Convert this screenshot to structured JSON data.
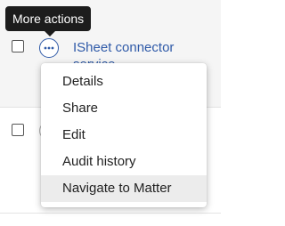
{
  "tooltip": {
    "text": "More actions"
  },
  "rows": [
    {
      "link_text": "ISheet connector service",
      "more_icon": "more-horizontal-circle-icon"
    },
    {
      "link_text": ""
    }
  ],
  "menu": {
    "items": [
      {
        "label": "Details"
      },
      {
        "label": "Share"
      },
      {
        "label": "Edit"
      },
      {
        "label": "Audit history"
      },
      {
        "label": "Navigate to Matter",
        "hovered": true
      }
    ]
  },
  "colors": {
    "link": "#2f5aa8",
    "tooltip_bg": "#1c1c1c",
    "row_highlight": "#f5f5f5",
    "menu_hover": "#ececec"
  }
}
